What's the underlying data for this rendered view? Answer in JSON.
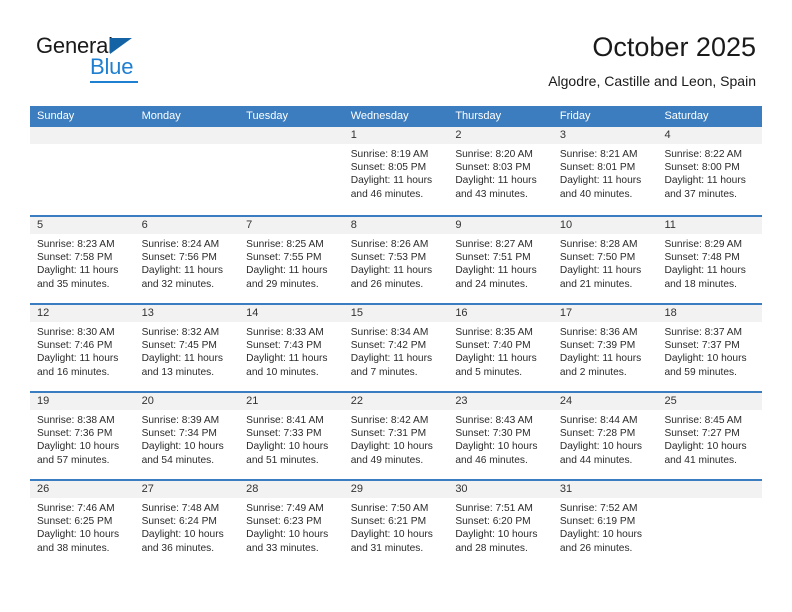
{
  "brand": {
    "name_top": "General",
    "name_bottom": "Blue",
    "triangle_icon": "triangle-icon",
    "accent_color": "#1f7fd0"
  },
  "header": {
    "title": "October 2025",
    "subtitle": "Algodre, Castille and Leon, Spain"
  },
  "theme": {
    "header_blue": "#3b7dbf",
    "day_band_gray": "#f2f2f2",
    "text_color": "#2b2b2b"
  },
  "weekday_headers": [
    "Sunday",
    "Monday",
    "Tuesday",
    "Wednesday",
    "Thursday",
    "Friday",
    "Saturday"
  ],
  "weeks": [
    [
      {
        "day": "",
        "empty": true
      },
      {
        "day": "",
        "empty": true
      },
      {
        "day": "",
        "empty": true
      },
      {
        "day": "1",
        "sunrise": "Sunrise: 8:19 AM",
        "sunset": "Sunset: 8:05 PM",
        "daylight_1": "Daylight: 11 hours",
        "daylight_2": "and 46 minutes."
      },
      {
        "day": "2",
        "sunrise": "Sunrise: 8:20 AM",
        "sunset": "Sunset: 8:03 PM",
        "daylight_1": "Daylight: 11 hours",
        "daylight_2": "and 43 minutes."
      },
      {
        "day": "3",
        "sunrise": "Sunrise: 8:21 AM",
        "sunset": "Sunset: 8:01 PM",
        "daylight_1": "Daylight: 11 hours",
        "daylight_2": "and 40 minutes."
      },
      {
        "day": "4",
        "sunrise": "Sunrise: 8:22 AM",
        "sunset": "Sunset: 8:00 PM",
        "daylight_1": "Daylight: 11 hours",
        "daylight_2": "and 37 minutes."
      }
    ],
    [
      {
        "day": "5",
        "sunrise": "Sunrise: 8:23 AM",
        "sunset": "Sunset: 7:58 PM",
        "daylight_1": "Daylight: 11 hours",
        "daylight_2": "and 35 minutes."
      },
      {
        "day": "6",
        "sunrise": "Sunrise: 8:24 AM",
        "sunset": "Sunset: 7:56 PM",
        "daylight_1": "Daylight: 11 hours",
        "daylight_2": "and 32 minutes."
      },
      {
        "day": "7",
        "sunrise": "Sunrise: 8:25 AM",
        "sunset": "Sunset: 7:55 PM",
        "daylight_1": "Daylight: 11 hours",
        "daylight_2": "and 29 minutes."
      },
      {
        "day": "8",
        "sunrise": "Sunrise: 8:26 AM",
        "sunset": "Sunset: 7:53 PM",
        "daylight_1": "Daylight: 11 hours",
        "daylight_2": "and 26 minutes."
      },
      {
        "day": "9",
        "sunrise": "Sunrise: 8:27 AM",
        "sunset": "Sunset: 7:51 PM",
        "daylight_1": "Daylight: 11 hours",
        "daylight_2": "and 24 minutes."
      },
      {
        "day": "10",
        "sunrise": "Sunrise: 8:28 AM",
        "sunset": "Sunset: 7:50 PM",
        "daylight_1": "Daylight: 11 hours",
        "daylight_2": "and 21 minutes."
      },
      {
        "day": "11",
        "sunrise": "Sunrise: 8:29 AM",
        "sunset": "Sunset: 7:48 PM",
        "daylight_1": "Daylight: 11 hours",
        "daylight_2": "and 18 minutes."
      }
    ],
    [
      {
        "day": "12",
        "sunrise": "Sunrise: 8:30 AM",
        "sunset": "Sunset: 7:46 PM",
        "daylight_1": "Daylight: 11 hours",
        "daylight_2": "and 16 minutes."
      },
      {
        "day": "13",
        "sunrise": "Sunrise: 8:32 AM",
        "sunset": "Sunset: 7:45 PM",
        "daylight_1": "Daylight: 11 hours",
        "daylight_2": "and 13 minutes."
      },
      {
        "day": "14",
        "sunrise": "Sunrise: 8:33 AM",
        "sunset": "Sunset: 7:43 PM",
        "daylight_1": "Daylight: 11 hours",
        "daylight_2": "and 10 minutes."
      },
      {
        "day": "15",
        "sunrise": "Sunrise: 8:34 AM",
        "sunset": "Sunset: 7:42 PM",
        "daylight_1": "Daylight: 11 hours",
        "daylight_2": "and 7 minutes."
      },
      {
        "day": "16",
        "sunrise": "Sunrise: 8:35 AM",
        "sunset": "Sunset: 7:40 PM",
        "daylight_1": "Daylight: 11 hours",
        "daylight_2": "and 5 minutes."
      },
      {
        "day": "17",
        "sunrise": "Sunrise: 8:36 AM",
        "sunset": "Sunset: 7:39 PM",
        "daylight_1": "Daylight: 11 hours",
        "daylight_2": "and 2 minutes."
      },
      {
        "day": "18",
        "sunrise": "Sunrise: 8:37 AM",
        "sunset": "Sunset: 7:37 PM",
        "daylight_1": "Daylight: 10 hours",
        "daylight_2": "and 59 minutes."
      }
    ],
    [
      {
        "day": "19",
        "sunrise": "Sunrise: 8:38 AM",
        "sunset": "Sunset: 7:36 PM",
        "daylight_1": "Daylight: 10 hours",
        "daylight_2": "and 57 minutes."
      },
      {
        "day": "20",
        "sunrise": "Sunrise: 8:39 AM",
        "sunset": "Sunset: 7:34 PM",
        "daylight_1": "Daylight: 10 hours",
        "daylight_2": "and 54 minutes."
      },
      {
        "day": "21",
        "sunrise": "Sunrise: 8:41 AM",
        "sunset": "Sunset: 7:33 PM",
        "daylight_1": "Daylight: 10 hours",
        "daylight_2": "and 51 minutes."
      },
      {
        "day": "22",
        "sunrise": "Sunrise: 8:42 AM",
        "sunset": "Sunset: 7:31 PM",
        "daylight_1": "Daylight: 10 hours",
        "daylight_2": "and 49 minutes."
      },
      {
        "day": "23",
        "sunrise": "Sunrise: 8:43 AM",
        "sunset": "Sunset: 7:30 PM",
        "daylight_1": "Daylight: 10 hours",
        "daylight_2": "and 46 minutes."
      },
      {
        "day": "24",
        "sunrise": "Sunrise: 8:44 AM",
        "sunset": "Sunset: 7:28 PM",
        "daylight_1": "Daylight: 10 hours",
        "daylight_2": "and 44 minutes."
      },
      {
        "day": "25",
        "sunrise": "Sunrise: 8:45 AM",
        "sunset": "Sunset: 7:27 PM",
        "daylight_1": "Daylight: 10 hours",
        "daylight_2": "and 41 minutes."
      }
    ],
    [
      {
        "day": "26",
        "sunrise": "Sunrise: 7:46 AM",
        "sunset": "Sunset: 6:25 PM",
        "daylight_1": "Daylight: 10 hours",
        "daylight_2": "and 38 minutes."
      },
      {
        "day": "27",
        "sunrise": "Sunrise: 7:48 AM",
        "sunset": "Sunset: 6:24 PM",
        "daylight_1": "Daylight: 10 hours",
        "daylight_2": "and 36 minutes."
      },
      {
        "day": "28",
        "sunrise": "Sunrise: 7:49 AM",
        "sunset": "Sunset: 6:23 PM",
        "daylight_1": "Daylight: 10 hours",
        "daylight_2": "and 33 minutes."
      },
      {
        "day": "29",
        "sunrise": "Sunrise: 7:50 AM",
        "sunset": "Sunset: 6:21 PM",
        "daylight_1": "Daylight: 10 hours",
        "daylight_2": "and 31 minutes."
      },
      {
        "day": "30",
        "sunrise": "Sunrise: 7:51 AM",
        "sunset": "Sunset: 6:20 PM",
        "daylight_1": "Daylight: 10 hours",
        "daylight_2": "and 28 minutes."
      },
      {
        "day": "31",
        "sunrise": "Sunrise: 7:52 AM",
        "sunset": "Sunset: 6:19 PM",
        "daylight_1": "Daylight: 10 hours",
        "daylight_2": "and 26 minutes."
      },
      {
        "day": "",
        "empty": true
      }
    ]
  ]
}
